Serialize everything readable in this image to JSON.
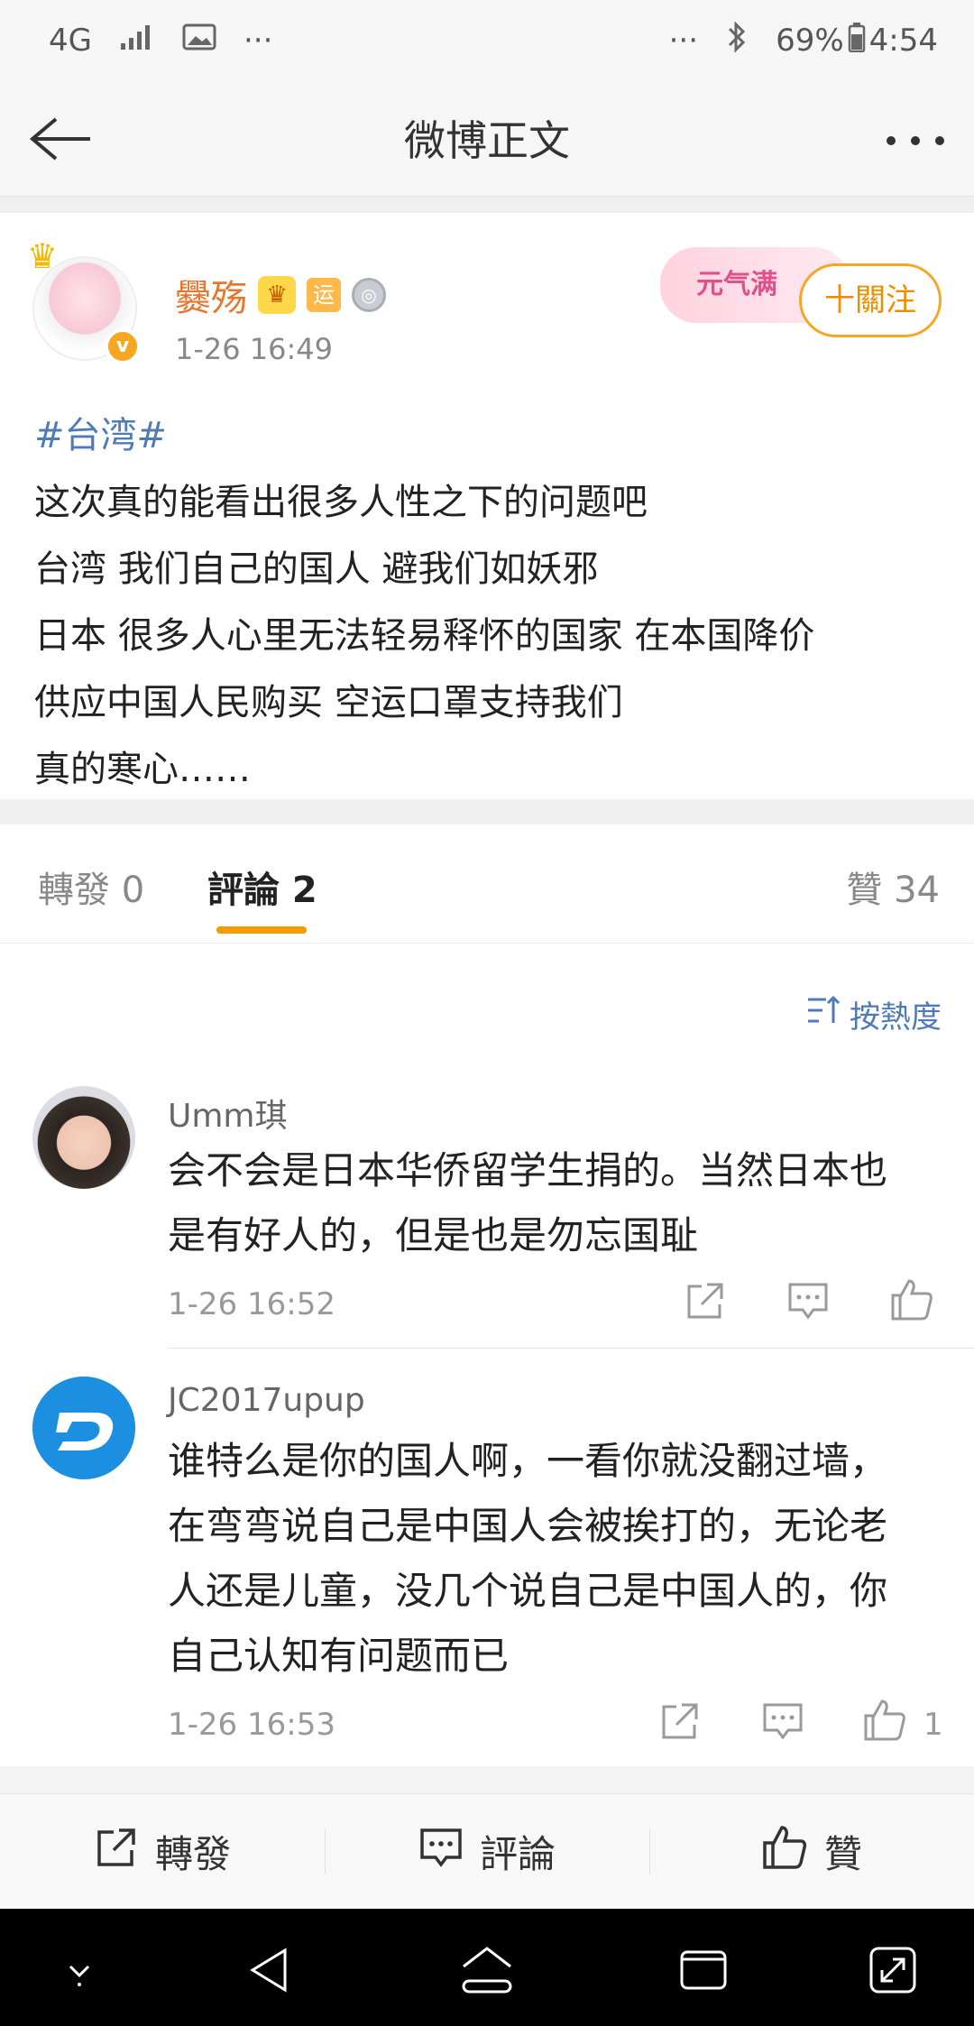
{
  "status_bar": {
    "network": "4G",
    "left_more": "···",
    "right_more": "···",
    "battery": "69%",
    "time": "4:54"
  },
  "nav": {
    "title": "微博正文"
  },
  "post": {
    "username": "爨殇",
    "badge_yun": "运",
    "time": "1-26 16:49",
    "follow_label": "十關注",
    "deco_text": "元气满",
    "hashtag": "#台湾#",
    "lines": [
      "这次真的能看出很多人性之下的问题吧",
      "台湾 我们自己的国人 避我们如妖邪",
      "日本 很多人心里无法轻易释怀的国家 在本国降价",
      "供应中国人民购买 空运口罩支持我们",
      "真的寒心……"
    ]
  },
  "tabs": {
    "repost": "轉發 0",
    "comments": "評論 2",
    "likes": "贊 34"
  },
  "sort_label": "按熱度",
  "comments": [
    {
      "name": "Umm琪",
      "lines": [
        "会不会是日本华侨留学生捐的。当然日本也",
        "是有好人的，但是也是勿忘国耻"
      ],
      "time": "1-26 16:52",
      "likes": ""
    },
    {
      "name": "JC2017upup",
      "lines": [
        "谁特么是你的国人啊，一看你就没翻过墙，",
        "在弯弯说自己是中国人会被挨打的，无论老",
        "人还是儿童，没几个说自己是中国人的，你",
        "自己认知有问题而已"
      ],
      "time": "1-26 16:53",
      "likes": "1"
    }
  ],
  "action_bar": {
    "repost": "轉發",
    "comment": "評論",
    "like": "贊"
  },
  "colors": {
    "accent_orange": "#f59b00",
    "link_blue": "#4e7bb8",
    "username_orange": "#e8772e"
  }
}
